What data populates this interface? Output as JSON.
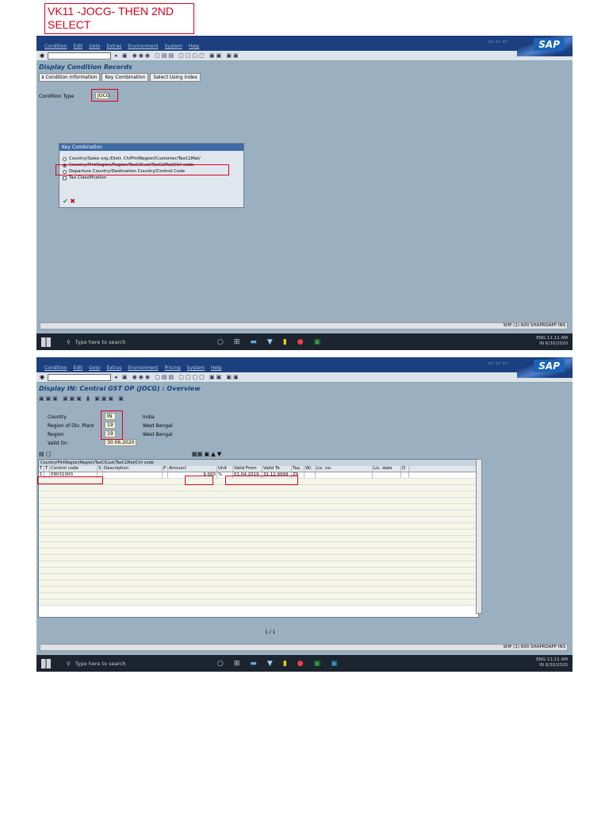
{
  "note": {
    "text": "VK11 -JOCG- THEN 2ND\nSELECT"
  },
  "screen1": {
    "menu": [
      "Condition",
      "Edit",
      "Goto",
      "Extras",
      "Environment",
      "System",
      "Help"
    ],
    "sap_logo": "SAP",
    "title": "Display Condition Records",
    "buttons": [
      "Condition Information",
      "Key Combination",
      "Select Using Index"
    ],
    "condition_type_label": "Condition Type",
    "condition_type_value": "JOCG",
    "popup": {
      "title": "Key Combination",
      "options": [
        "Country/Sales org./Distr. Ch/PlntRegion/Customer/TaxCLMat/",
        "Country/PlntRegion/Region/TaxClCust/TaxCLMat/Ctrl code",
        "Departure Country/Destination Country/Control Code",
        "Tax Classification"
      ]
    },
    "status": "SHP (1) 600  SHAPRDAPP  INS"
  },
  "screen2": {
    "menu": [
      "Condition",
      "Edit",
      "Goto",
      "Extras",
      "Environment",
      "Pricing",
      "System",
      "Help"
    ],
    "sap_logo": "SAP",
    "title": "Display IN: Central GST OP (JOCG) : Overview",
    "header_fields": [
      {
        "label": "Country",
        "value": "IN",
        "text": "India"
      },
      {
        "label": "Region of Dlv. Plant",
        "value": "19",
        "text": "West Bengal"
      },
      {
        "label": "Region",
        "value": "19",
        "text": "West Bengal"
      },
      {
        "label": "Valid On",
        "value": "30.06.2020",
        "text": ""
      }
    ],
    "grid_title": "Country/PlntRegion/Region/TaxClCust/TaxCLMat/Ctrl code",
    "columns": [
      "T",
      "T",
      "Control code",
      "S",
      "Description",
      "P",
      "Amount",
      "Unit",
      "Valid From",
      "Valid To",
      "Tax.",
      "W/.",
      "Lic. no.",
      "Lic. date",
      "D"
    ],
    "rows": [
      {
        "t1": "1",
        "t2": "",
        "control_code": "09031000",
        "amount": "9.000",
        "unit": "%",
        "valid_from": "01.04.2019",
        "valid_to": "31.12.9999",
        "tax": "Z9"
      }
    ],
    "pager": "1 / 1",
    "status": "SHP (1) 600  SHAPRDAPP  INS"
  },
  "taskbar": {
    "search_placeholder": "Type here to search",
    "lang": "ENG",
    "region": "IN",
    "time": "11:11 AM",
    "date": "6/30/2020"
  }
}
